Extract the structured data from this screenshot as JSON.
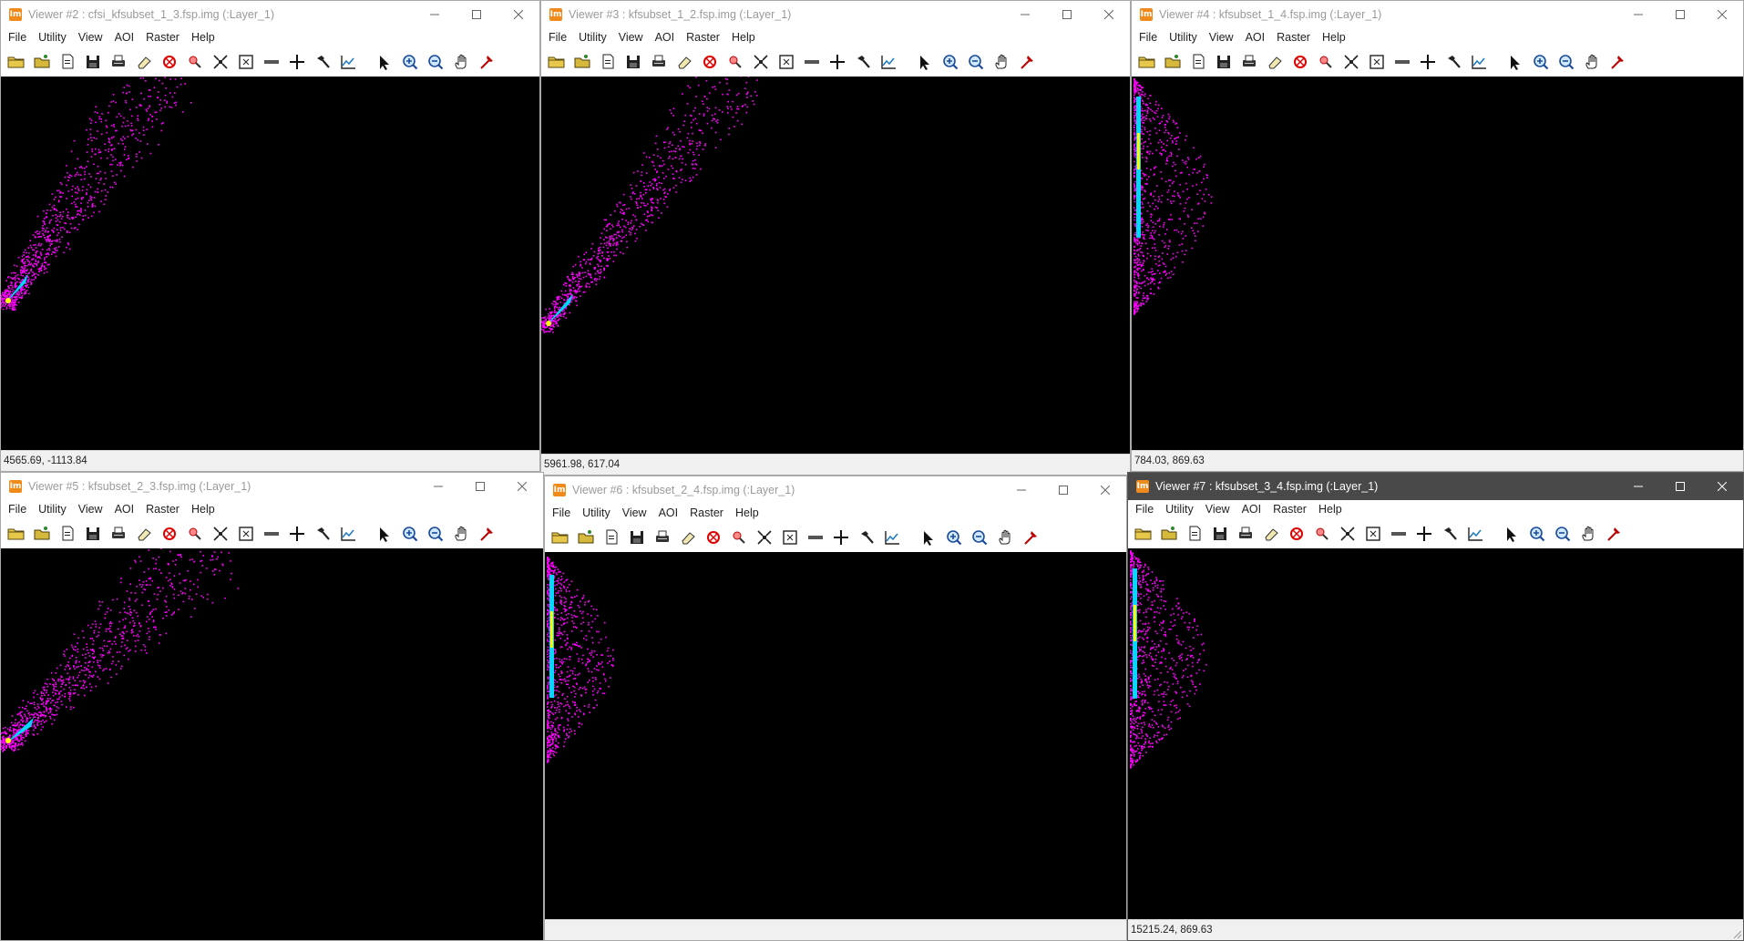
{
  "menu": [
    "File",
    "Utility",
    "View",
    "AOI",
    "Raster",
    "Help"
  ],
  "toolbar_icons": [
    "open-folder-icon",
    "open-layer-icon",
    "new-document-icon",
    "save-icon",
    "print-icon",
    "eraser-icon",
    "clear-view-icon",
    "inquire-icon",
    "fit-extent-icon",
    "zoom-extent-icon",
    "measure-icon",
    "crosshair-icon",
    "hammer-icon",
    "profile-icon",
    "select-arrow-icon",
    "zoom-in-icon",
    "zoom-out-icon",
    "pan-hand-icon",
    "pick-tool-icon"
  ],
  "viewers": [
    {
      "title": "Viewer #2 : cfsi_kfsubset_1_3.fsp.img (:Layer_1)",
      "status": "4565.69, -1113.84",
      "active": false
    },
    {
      "title": "Viewer #3 : kfsubset_1_2.fsp.img (:Layer_1)",
      "status": "5961.98, 617.04",
      "active": false
    },
    {
      "title": "Viewer #4 : kfsubset_1_4.fsp.img (:Layer_1)",
      "status": "784.03, 869.63",
      "active": false
    },
    {
      "title": "Viewer #5 : kfsubset_2_3.fsp.img (:Layer_1)",
      "status": "",
      "active": false
    },
    {
      "title": "Viewer #6 : kfsubset_2_4.fsp.img (:Layer_1)",
      "status": "",
      "active": false
    },
    {
      "title": "Viewer #7 : kfsubset_3_4.fsp.img (:Layer_1)",
      "status": "15215.24, 869.63",
      "active": true
    }
  ],
  "colors": {
    "canvas": "#000000",
    "scatter_low": "#ff00ff",
    "scatter_mid": "#00d8ff",
    "scatter_high": "#ffff00",
    "accent_icon": "#f08a1a"
  }
}
